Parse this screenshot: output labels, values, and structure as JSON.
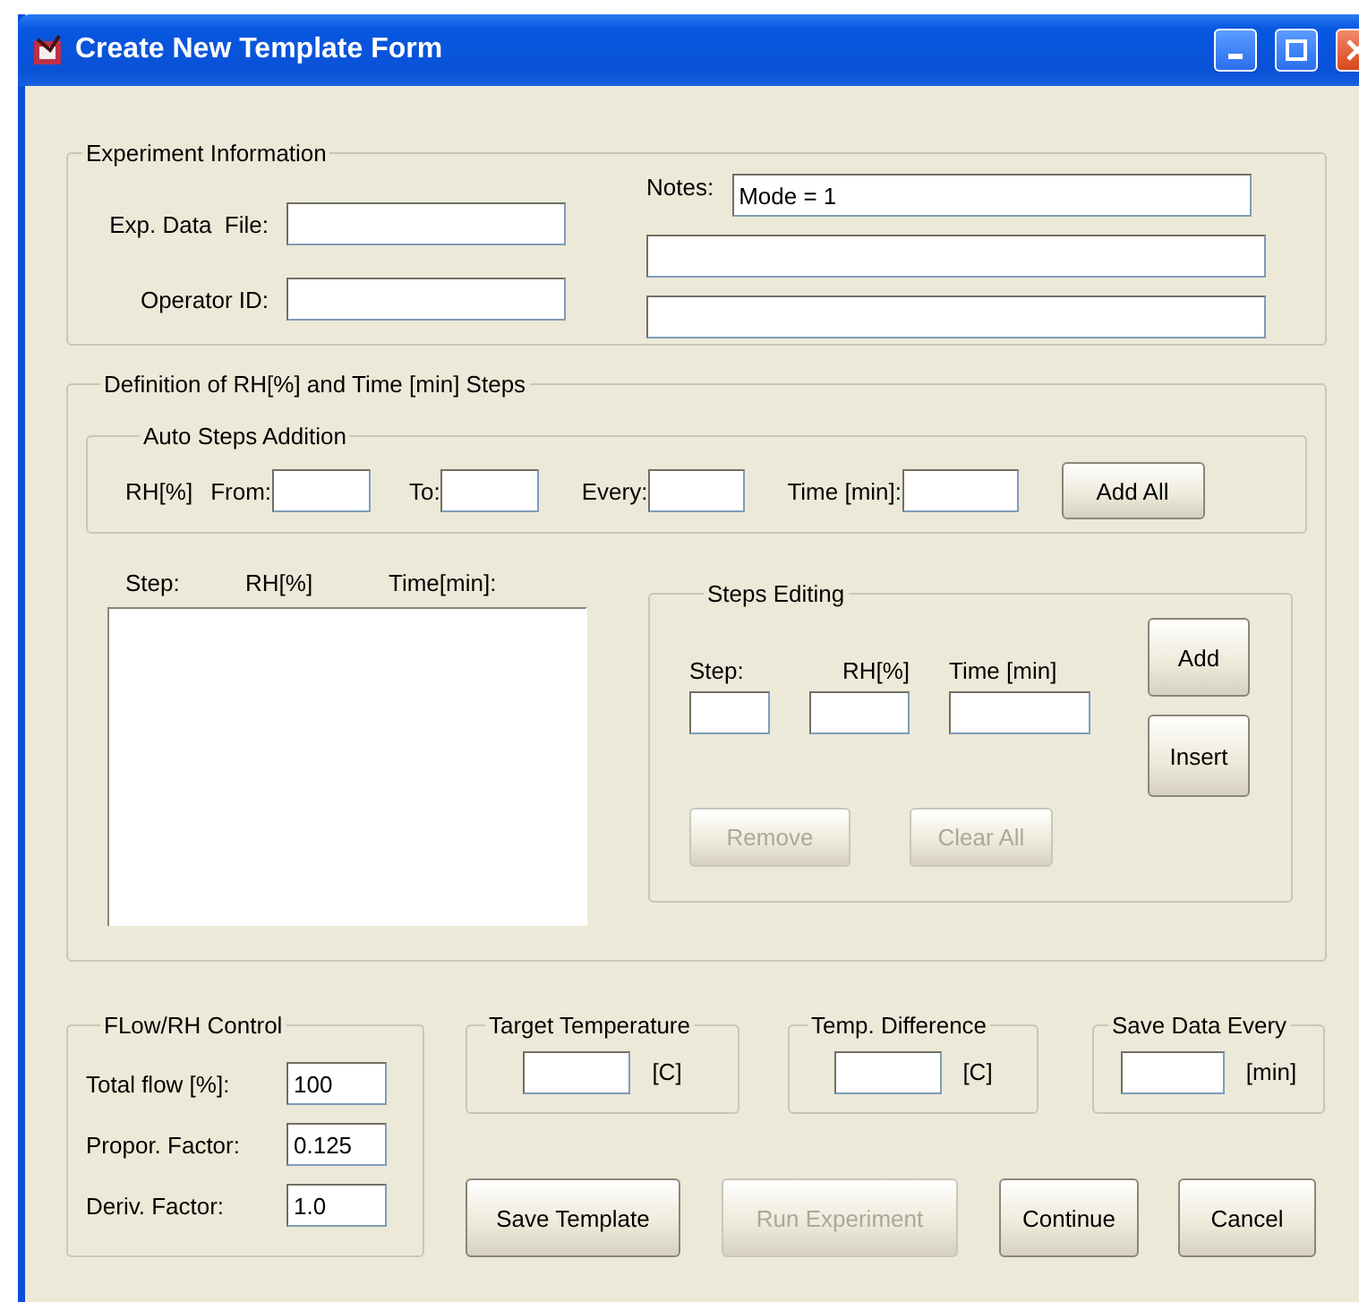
{
  "window": {
    "title": "Create New Template Form"
  },
  "experiment_info": {
    "title": "Experiment Information",
    "fields": [
      {
        "label": "Exp. Data  File:"
      },
      {
        "label": "Operator ID:"
      }
    ],
    "notes": {
      "label": "Notes:",
      "value": "Mode = 1"
    }
  },
  "steps_definition": {
    "title": "Definition of RH[%] and Time [min] Steps",
    "auto": {
      "title": "Auto Steps Addition",
      "prefix": "RH[%]",
      "fields": [
        {
          "label": "From:"
        },
        {
          "label": "To:"
        },
        {
          "label": "Every:"
        },
        {
          "label": "Time [min]:"
        }
      ],
      "button": {
        "label": "Add All",
        "disabled": false
      }
    },
    "list": {
      "columns": [
        "Step:",
        "RH[%]",
        "Time[min]:"
      ]
    },
    "editing": {
      "title": "Steps Editing",
      "fields": [
        {
          "label": "Step:"
        },
        {
          "label": "RH[%]"
        },
        {
          "label": "Time [min]"
        }
      ],
      "side_buttons": [
        {
          "label": "Add",
          "disabled": false
        },
        {
          "label": "Insert",
          "disabled": false
        }
      ],
      "bottom_buttons": [
        {
          "label": "Remove",
          "disabled": true
        },
        {
          "label": "Clear All",
          "disabled": true
        }
      ]
    }
  },
  "flow_control": {
    "title": "FLow/RH Control",
    "fields": [
      {
        "label": "Total flow [%]:",
        "value": "100"
      },
      {
        "label": "Propor. Factor:",
        "value": "0.125"
      },
      {
        "label": "Deriv. Factor:",
        "value": "1.0"
      }
    ]
  },
  "settings": [
    {
      "title": "Target Temperature",
      "unit": "[C]"
    },
    {
      "title": "Temp. Difference",
      "unit": "[C]"
    },
    {
      "title": "Save Data Every",
      "unit": "[min]"
    }
  ],
  "buttons": [
    {
      "label": "Save Template",
      "disabled": false
    },
    {
      "label": "Run Experiment",
      "disabled": true
    },
    {
      "label": "Continue",
      "disabled": false
    },
    {
      "label": "Cancel",
      "disabled": false
    }
  ]
}
